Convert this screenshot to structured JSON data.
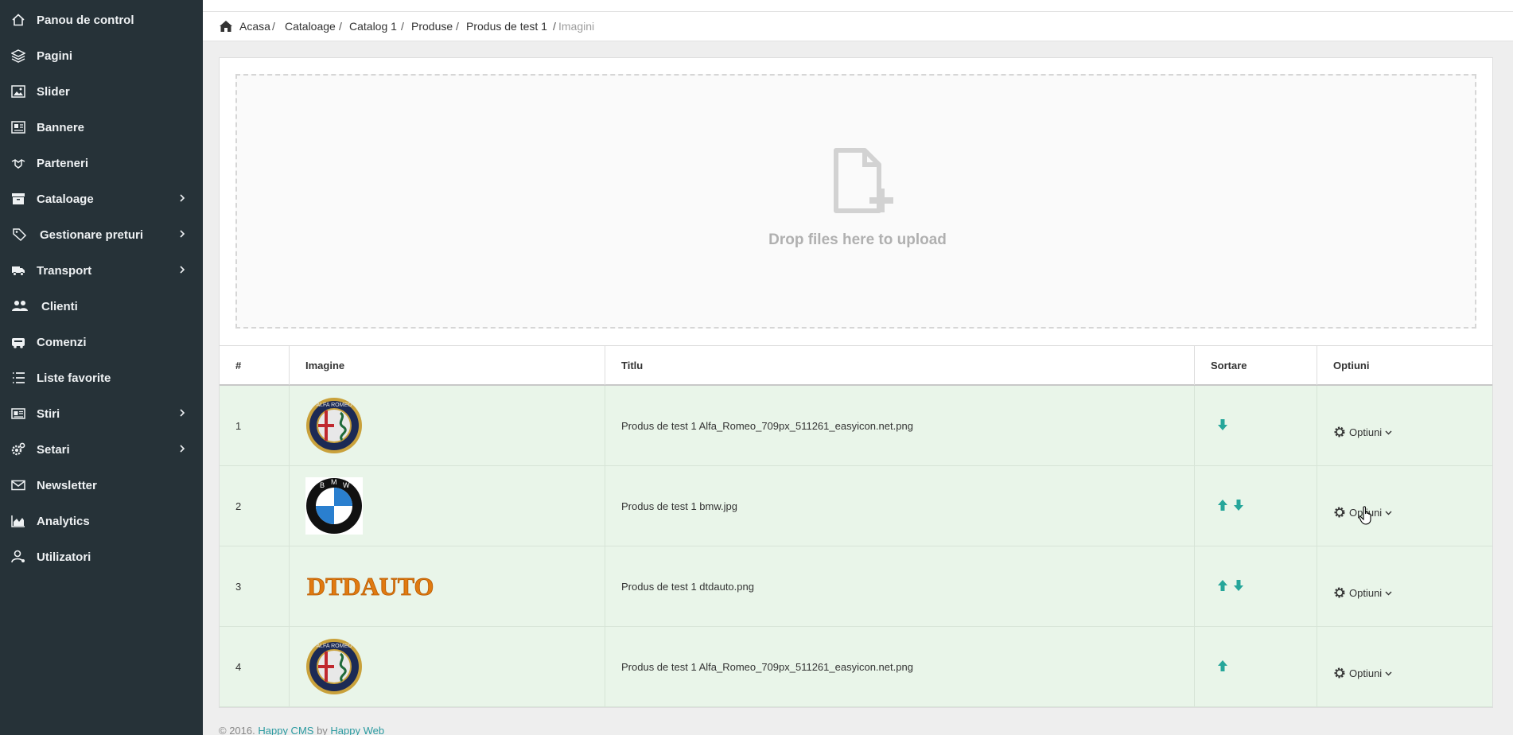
{
  "sidebar": {
    "items": [
      {
        "label": "Panou de control",
        "icon": "home-outline-icon",
        "has_submenu": false
      },
      {
        "label": "Pagini",
        "icon": "layers-icon",
        "has_submenu": false
      },
      {
        "label": "Slider",
        "icon": "image-icon",
        "has_submenu": false
      },
      {
        "label": "Bannere",
        "icon": "banner-icon",
        "has_submenu": false
      },
      {
        "label": "Parteneri",
        "icon": "partners-icon",
        "has_submenu": false
      },
      {
        "label": "Cataloage",
        "icon": "archive-icon",
        "has_submenu": true
      },
      {
        "label": "Gestionare preturi",
        "icon": "tags-icon",
        "has_submenu": true
      },
      {
        "label": "Transport",
        "icon": "truck-icon",
        "has_submenu": true
      },
      {
        "label": "Clienti",
        "icon": "users-icon",
        "has_submenu": false
      },
      {
        "label": "Comenzi",
        "icon": "cart-icon",
        "has_submenu": false
      },
      {
        "label": "Liste favorite",
        "icon": "list-icon",
        "has_submenu": false
      },
      {
        "label": "Stiri",
        "icon": "news-icon",
        "has_submenu": true
      },
      {
        "label": "Setari",
        "icon": "cogs-icon",
        "has_submenu": true
      },
      {
        "label": "Newsletter",
        "icon": "envelope-icon",
        "has_submenu": false
      },
      {
        "label": "Analytics",
        "icon": "area-chart-icon",
        "has_submenu": false
      },
      {
        "label": "Utilizatori",
        "icon": "user-icon",
        "has_submenu": false
      }
    ]
  },
  "breadcrumb": {
    "items": [
      "Acasa",
      "Cataloage",
      "Catalog 1",
      "Produse",
      "Produs de test 1"
    ],
    "current": "Imagini"
  },
  "dropzone": {
    "text": "Drop files here to upload"
  },
  "table": {
    "headers": [
      "#",
      "Imagine",
      "Titlu",
      "Sortare",
      "Optiuni"
    ],
    "rows": [
      {
        "num": "1",
        "image": "alfa-romeo-logo",
        "title": "Produs de test 1 Alfa_Romeo_709px_511261_easyicon.net.png",
        "sort": [
          "down"
        ],
        "options_label": "Optiuni"
      },
      {
        "num": "2",
        "image": "bmw-logo",
        "title": "Produs de test 1 bmw.jpg",
        "sort": [
          "up",
          "down"
        ],
        "options_label": "Optiuni"
      },
      {
        "num": "3",
        "image": "dtdauto-logo",
        "title": "Produs de test 1 dtdauto.png",
        "sort": [
          "up",
          "down"
        ],
        "options_label": "Optiuni"
      },
      {
        "num": "4",
        "image": "alfa-romeo-logo",
        "title": "Produs de test 1 Alfa_Romeo_709px_511261_easyicon.net.png",
        "sort": [
          "up"
        ],
        "options_label": "Optiuni"
      }
    ]
  },
  "images": {
    "bmw_letters": [
      "B",
      "M",
      "W"
    ],
    "dtdauto_text": "DTDAUTO",
    "alfa_text": "ALFA ROMEO"
  },
  "footer": {
    "prefix": "© 2016.",
    "cms": "Happy CMS",
    "by": "by",
    "company": "Happy Web"
  },
  "colors": {
    "sidebar": "#263238",
    "accent": "#26a69a",
    "row": "#e9f5e9",
    "link": "#2a9aa0"
  }
}
